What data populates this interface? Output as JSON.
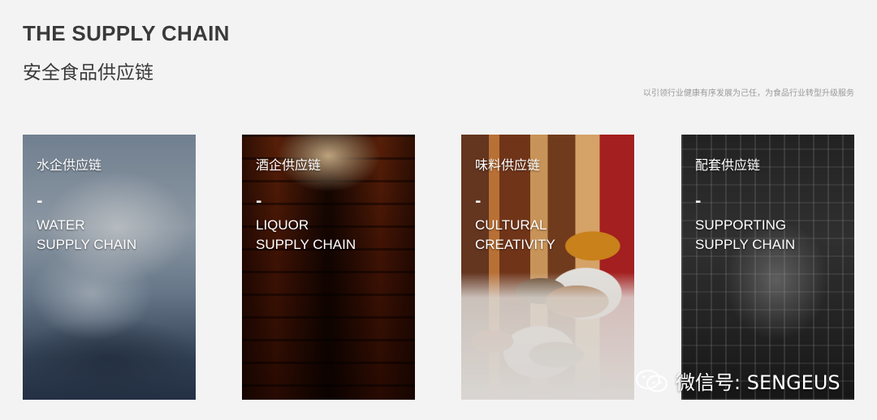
{
  "header": {
    "title_en": "THE SUPPLY CHAIN",
    "title_cn": "安全食品供应链",
    "tagline": "以引领行业健康有序发展为己任，为食品行业转型升级服务"
  },
  "cards": [
    {
      "title_cn": "水企供应链",
      "dash": "-",
      "line1": "WATER",
      "line2": "SUPPLY CHAIN"
    },
    {
      "title_cn": "酒企供应链",
      "dash": "-",
      "line1": "LIQUOR",
      "line2": "SUPPLY CHAIN"
    },
    {
      "title_cn": "味料供应链",
      "dash": "-",
      "line1": "CULTURAL",
      "line2": "CREATIVITY"
    },
    {
      "title_cn": "配套供应链",
      "dash": "-",
      "line1": "SUPPORTING",
      "line2": "SUPPLY CHAIN"
    }
  ],
  "watermark": {
    "text": "微信号: SENGEUS",
    "icon": "wechat-icon"
  }
}
